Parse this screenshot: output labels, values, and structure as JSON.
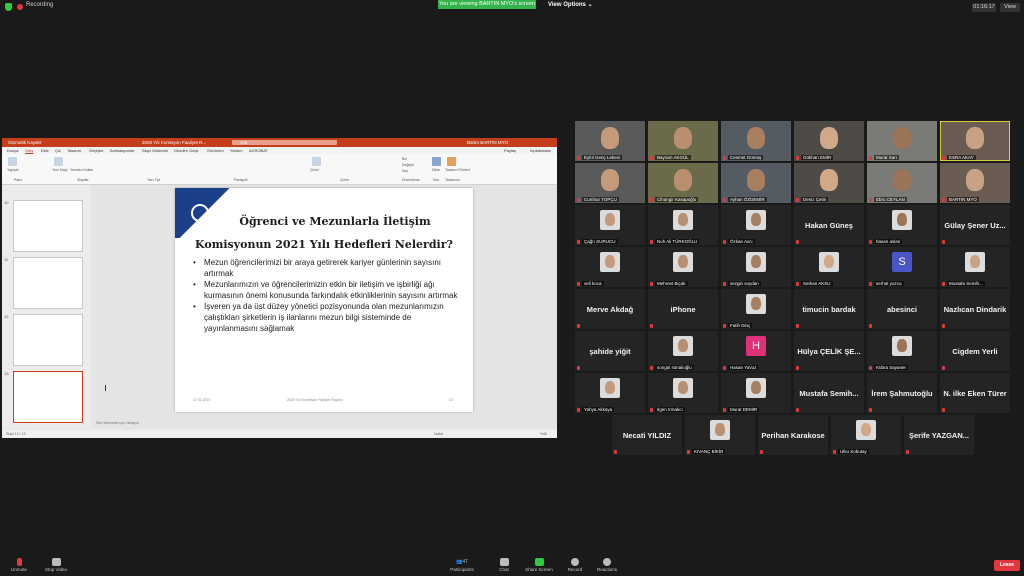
{
  "topbar": {
    "recording_label": "Recording",
    "viewing_banner": "You are viewing BARTIN MYO's screen",
    "view_options": "View Options",
    "timer": "01:16:17",
    "view_label": "View"
  },
  "ppt": {
    "autosave": "Otomatik Kaydet",
    "filename": "2020 Yılı Komisyon Faaliyet R...",
    "search_placeholder": "Ara",
    "user": "Bartın BARTIN MYO",
    "tabs": [
      "Dosya",
      "Giriş",
      "Ekle",
      "Çiz",
      "Tasarım",
      "Geçişler",
      "Animasyonlar",
      "Slayt Gösterisi",
      "Gözden Geçir",
      "Görünüm",
      "Yardım",
      "ACROBAT"
    ],
    "share_label": "Paylaş",
    "comments_label": "Açıklamalar",
    "ribbon_groups": [
      "Pano",
      "Slaytlar",
      "Yazı Tipi",
      "Paragraf",
      "Çizim",
      "Düzenleme",
      "Ses",
      "Tasarımcı"
    ],
    "ribbon_items": [
      "Yapıştır",
      "Yeni Slayt",
      "Yeniden Kullan",
      "Çizim",
      "Bul",
      "Değiştir",
      "Seç",
      "Dikte",
      "Tasarım Fikirleri"
    ],
    "slide_numbers": [
      "10",
      "11",
      "12",
      "13"
    ],
    "notes_placeholder": "Not eklemek için tıklayın",
    "status_left": "Slayt 13 / 13",
    "status_notes": "Notlar",
    "zoom": "%46"
  },
  "slide": {
    "title_line1": "Öğrenci ve Mezunlarla İletişim",
    "title_line2": "Komisyonun 2021 Yılı  Hedefleri Nelerdir?",
    "bullets": [
      "Mezun öğrencilerimizi bir araya getirerek kariyer günlerinin sayısını artırmak",
      "Mezunlarımızın ve öğrencilerimizin etkin bir iletişim ve işbirliği ağı kurmasının önemi konusunda farkındalık etkinliklerinin sayısını artırmak",
      "İşveren ya da üst düzey yönetici pozisyonunda olan mezunlarımızın çalıştıkları şirketlerin iş ilanlarını mezun bilgi sisteminde de yayınlanmasını sağlamak"
    ],
    "footer_date": "17.02.2021",
    "footer_title": "2020 Yılı Komisyon Faaliyet Raporu",
    "footer_page": "13"
  },
  "participants": [
    {
      "label": "Eylül Genç Lekesi",
      "type": "video"
    },
    {
      "label": "Bayram AKGÜL",
      "type": "video"
    },
    {
      "label": "Cesmet Gümüş",
      "type": "video"
    },
    {
      "label": "Gökhan EMİR",
      "type": "video"
    },
    {
      "label": "Murat Sarı",
      "type": "video"
    },
    {
      "label": "ESRA AKAY",
      "type": "video"
    },
    {
      "label": "Cumhur TOPÇU",
      "type": "video"
    },
    {
      "label": "Cihangir Kasapoğlu",
      "type": "video"
    },
    {
      "label": "Ayhan ÖZDEMİR",
      "type": "video"
    },
    {
      "label": "Deniz Çetin",
      "type": "video"
    },
    {
      "label": "Ebru CEYLAN",
      "type": "video"
    },
    {
      "label": "BARTIN MYO",
      "type": "video"
    },
    {
      "label": "Çağrı SURUCU",
      "type": "photo"
    },
    {
      "label": "Nuh Ali TÜRKOĞLU",
      "type": "photo"
    },
    {
      "label": "Özkan Avcı",
      "type": "photo"
    },
    {
      "name": "Hakan Güneş",
      "type": "name"
    },
    {
      "label": "hasan aslan",
      "type": "photo"
    },
    {
      "name": "Gülay Şener Uz...",
      "type": "name"
    },
    {
      "label": "veli koca",
      "type": "photo"
    },
    {
      "label": "Mehmet Biçak",
      "type": "photo"
    },
    {
      "label": "sezgin soydan",
      "type": "photo"
    },
    {
      "label": "Serkan AKSU",
      "type": "photo"
    },
    {
      "label": "serhat yozcu",
      "type": "letter",
      "letter": "S",
      "color": "#4a55c7"
    },
    {
      "label": "Mustafa Semih...",
      "type": "photo"
    },
    {
      "name": "Merve Akdağ",
      "type": "name"
    },
    {
      "name": "iPhone",
      "type": "name"
    },
    {
      "label": "Fatih Dinç",
      "type": "photo"
    },
    {
      "name": "timucin bardak",
      "type": "name"
    },
    {
      "name": "abesinci",
      "type": "name"
    },
    {
      "name": "Nazlıcan Dindarik",
      "type": "name"
    },
    {
      "name": "şahide yiğit",
      "type": "name"
    },
    {
      "label": "songül sönalioğlu",
      "type": "photo"
    },
    {
      "label": "Hasan Yavuz",
      "type": "letter",
      "letter": "H",
      "color": "#e0307a"
    },
    {
      "name": "Hülya ÇELİK ŞE...",
      "type": "name"
    },
    {
      "label": "Kübra Sayaner",
      "type": "photo"
    },
    {
      "name": "Cigdem Yerli",
      "type": "name"
    },
    {
      "label": "Yahya Akkaya",
      "type": "photo"
    },
    {
      "label": "Ilgen Irmakcı",
      "type": "photo"
    },
    {
      "label": "Murat DEMİR",
      "type": "photo"
    },
    {
      "name": "Mustafa Semih...",
      "type": "name"
    },
    {
      "name": "İrem Şahmutoğlu",
      "type": "name"
    },
    {
      "name": "N. ilke Eken Türer",
      "type": "name"
    },
    {
      "name": "Necati YILDIZ",
      "type": "name"
    },
    {
      "label": "KIVANÇ BİKİR",
      "type": "photo"
    },
    {
      "name": "Perihan Karakose",
      "type": "name"
    },
    {
      "label": "Ulku Sobutay",
      "type": "photo"
    },
    {
      "name": "Şerife  YAZGAN...",
      "type": "name"
    }
  ],
  "toolbar": {
    "unmute": "Unmute",
    "stop_video": "Stop Video",
    "participants": "Participants",
    "participants_count": "47",
    "chat": "Chat",
    "share_screen": "Share Screen",
    "record": "Record",
    "reactions": "Reactions",
    "leave": "Leave"
  }
}
